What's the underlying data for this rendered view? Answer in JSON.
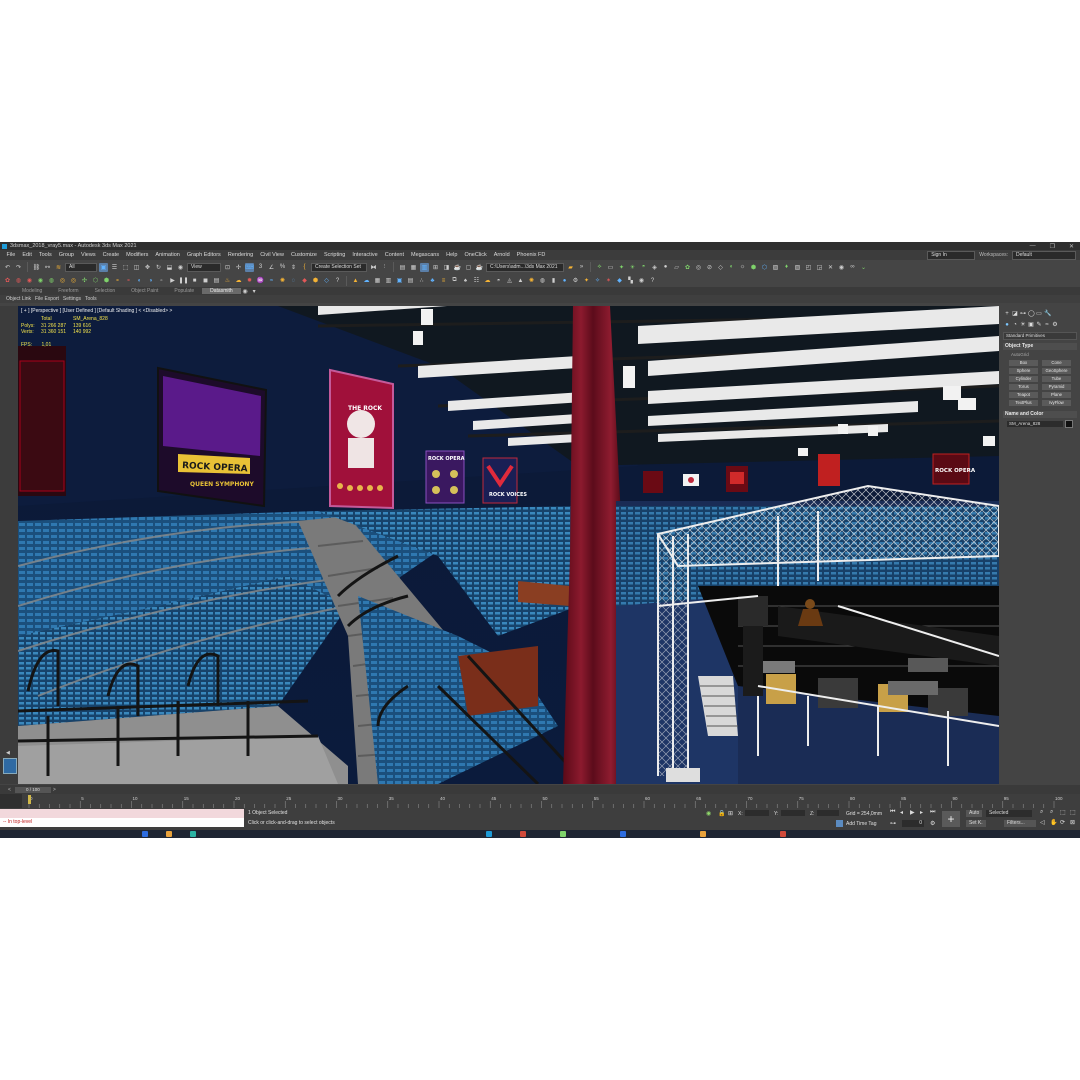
{
  "window": {
    "title": "3dsmax_2018_vray5.max - Autodesk 3ds Max 2021",
    "controls": [
      "—",
      "❐",
      "✕"
    ]
  },
  "menubar": {
    "items": [
      "File",
      "Edit",
      "Tools",
      "Group",
      "Views",
      "Create",
      "Modifiers",
      "Animation",
      "Graph Editors",
      "Rendering",
      "Civil View",
      "Customize",
      "Scripting",
      "Interactive",
      "Content",
      "Megascans",
      "Help",
      "OneClick",
      "Arnold",
      "Phoenix FD"
    ],
    "signin": "Sign In",
    "workspaces_label": "Workspaces:",
    "workspaces_value": "Default"
  },
  "toolbar": {
    "filter_value": "All",
    "view_value": "View",
    "selection_set": "Create Selection Set",
    "path_value": "C:\\Users\\adm...\\3ds Max 2021",
    "icon_colors": {
      "blue": "#61b3ff",
      "orange": "#f5b335",
      "green": "#7fd36b",
      "red": "#e25858"
    }
  },
  "ribbon": {
    "tabs": [
      "Modeling",
      "Freeform",
      "Selection",
      "Object Paint",
      "Populate",
      "Datasmith"
    ],
    "active": "Datasmith"
  },
  "scene_explorer": {
    "items": [
      "Object Link",
      "File Export",
      "Settings",
      "Tools"
    ]
  },
  "viewport": {
    "label": "[ + ] [Perspective ] [User Defined ] [Default Shading ]  < <Disabled> >",
    "stats": {
      "header": "Total",
      "header2": "SM_Arena_828",
      "rows": [
        {
          "label": "Polys:",
          "total": "31 266 287",
          "selected": "139 616"
        },
        {
          "label": "Verts:",
          "total": "31 360 151",
          "selected": "140 992"
        }
      ]
    },
    "fps_label": "FPS:",
    "fps_value": "1,01",
    "posters": {
      "p1_title": "ROCK OPERA",
      "p1_sub": "QUEEN SYMPHONY",
      "p2_title": "THE ROCK",
      "p3_title": "ROCK OPERA",
      "p4_title": "ROCK VOICES",
      "p5_title": "ROCK OPERA"
    },
    "background": "#0e1a33"
  },
  "command_panel": {
    "category": "Standard Primitives",
    "object_type_title": "Object Type",
    "autogrid": "AutoGrid",
    "primitives": [
      "Box",
      "Cone",
      "Sphere",
      "GeoSphere",
      "Cylinder",
      "Tube",
      "Torus",
      "Pyramid",
      "Teapot",
      "Plane",
      "TextPlus",
      "IvyFlow"
    ],
    "name_color_title": "Name and Color",
    "object_name": "SM_Arena_828"
  },
  "trackbar": {
    "frame": "0 / 100",
    "ticks": [
      "0",
      "5",
      "10",
      "15",
      "20",
      "25",
      "30",
      "35",
      "40",
      "45",
      "50",
      "55",
      "60",
      "65",
      "70",
      "75",
      "80",
      "85",
      "90",
      "95",
      "100"
    ]
  },
  "status": {
    "maxscript_line1": "",
    "maxscript_line2": "-- In top-level",
    "selected": "1 Object Selected",
    "prompt": "Click or click-and-drag to select objects",
    "x_label": "X:",
    "y_label": "Y:",
    "z_label": "Z:",
    "grid": "Grid = 254,0mm",
    "add_time_tag": "Add Time Tag",
    "auto_btn": "Auto",
    "setk_btn": "Set K.",
    "selected_dd": "Selected",
    "filters_btn": "Filters...",
    "frame_value": "0"
  }
}
